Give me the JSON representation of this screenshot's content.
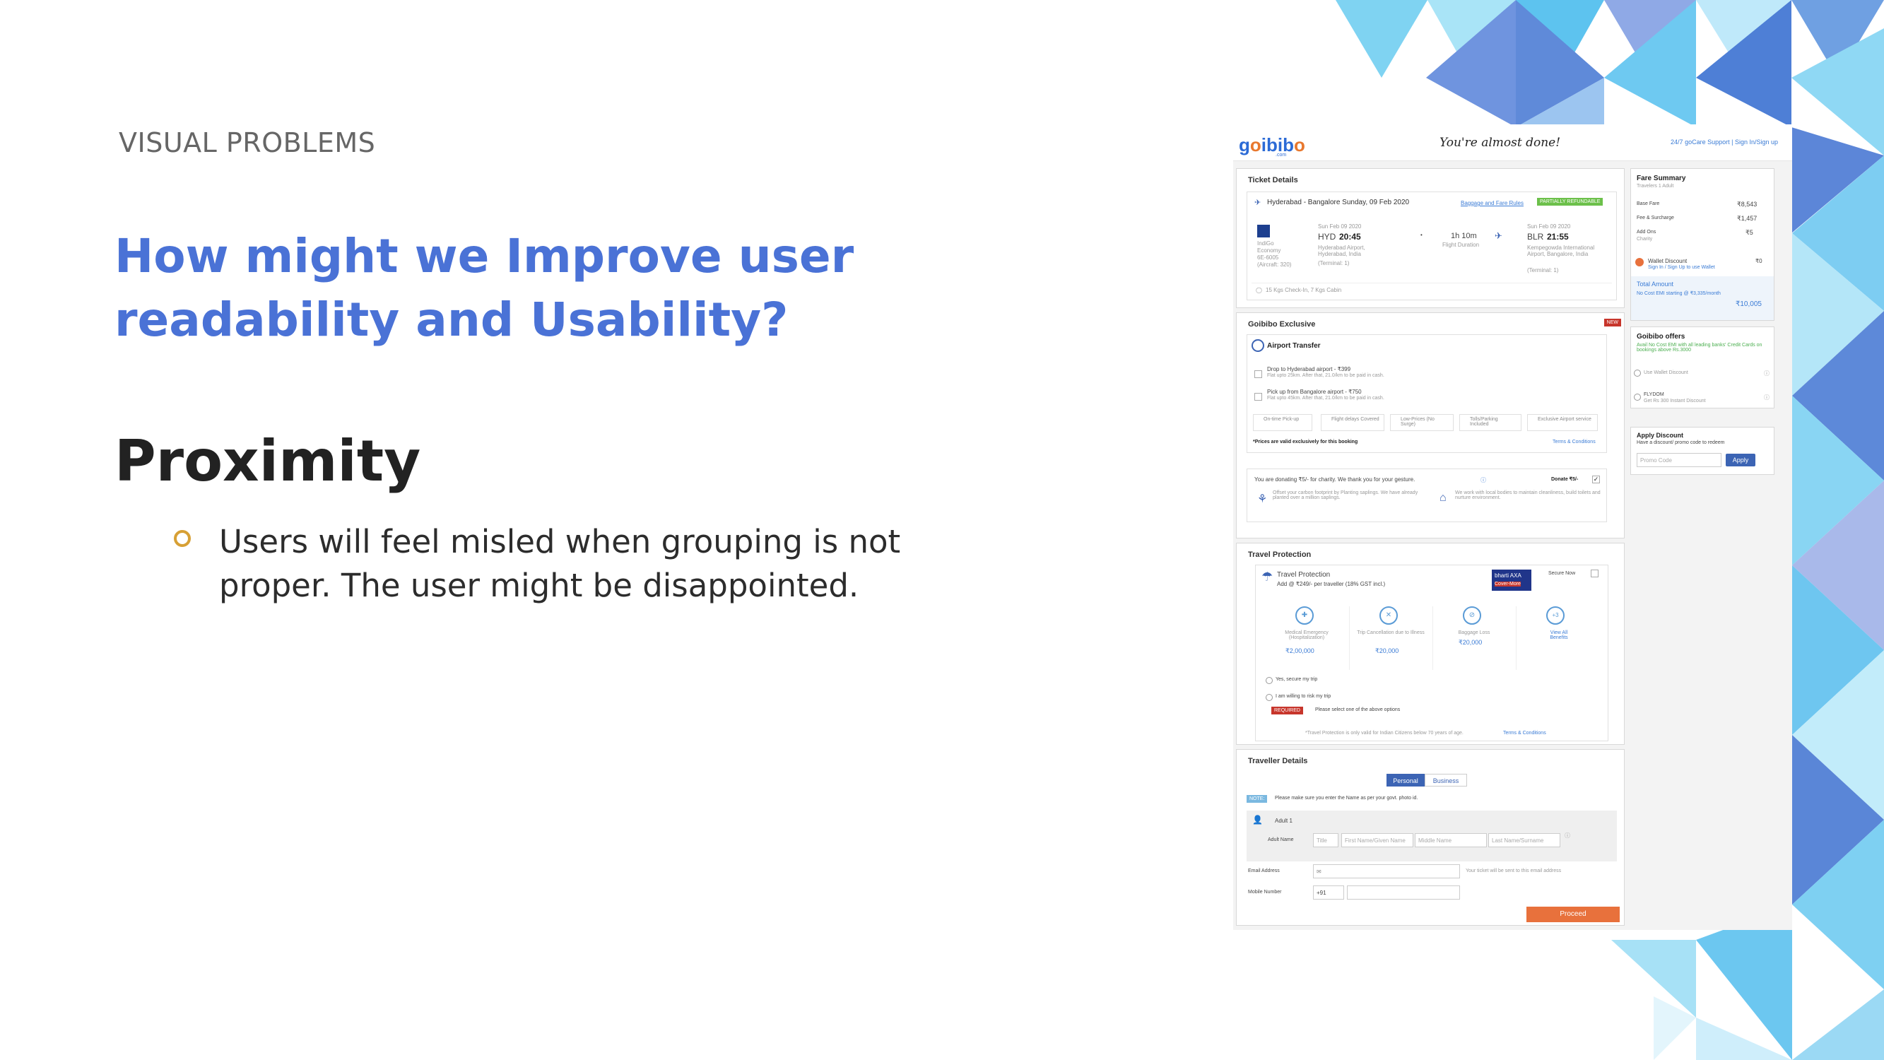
{
  "slide": {
    "section_label": "VISUAL PROBLEMS",
    "question": "How might we Improve user readability and Usability?",
    "principle": "Proximity",
    "bullet": "Users will feel misled when grouping is not proper. The user might be disappointed."
  },
  "colors": {
    "accent_blue": "#4a72d6",
    "bullet_ring": "#d7a035",
    "proceed": "#e8713c",
    "primary": "#3c64b4"
  },
  "screenshot": {
    "logo": "goibibo",
    "logo_sub": ".com",
    "tagline": "You're almost done!",
    "support": "24/7 goCare Support | Sign In/Sign up",
    "ticket": {
      "title": "Ticket Details",
      "route": "Hyderabad - Bangalore Sunday, 09 Feb 2020",
      "rules_link": "Baggage and Fare Rules",
      "refund_badge": "PARTIALLY REFUNDABLE",
      "airline": "IndiGo",
      "airline_class": "Economy",
      "flight_no": "6E-6005",
      "aircraft": "(Aircraft: 320)",
      "dep_date": "Sun Feb 09 2020",
      "dep_code": "HYD",
      "dep_time": "20:45",
      "dep_airport": "Hyderabad Airport, Hyderabad, India",
      "dep_terminal": "(Terminal: 1)",
      "duration": "1h 10m",
      "duration_label": "Flight Duration",
      "arr_date": "Sun Feb 09 2020",
      "arr_code": "BLR",
      "arr_time": "21:55",
      "arr_airport": "Kempegowda International Airport, Bangalore, India",
      "arr_terminal": "(Terminal: 1)",
      "baggage": "15 Kgs Check-In, 7 Kgs Cabin"
    },
    "exclusive": {
      "title": "Goibibo Exclusive",
      "new_badge": "NEW",
      "transfer_title": "Airport Transfer",
      "opt1": "Drop to Hyderabad airport - ₹399",
      "opt1_sub": "Flat upto 25km. After that, 21.0/km to be paid in cash.",
      "opt2": "Pick up from Bangalore airport - ₹750",
      "opt2_sub": "Flat upto 45km. After that, 21.0/km to be paid in cash.",
      "features": [
        "On-time Pick-up",
        "Flight delays Covered",
        "Low-Prices (No Surge)",
        "Tolls/Parking Included",
        "Exclusive Airport service"
      ],
      "prices_note": "*Prices are valid exclusively for this booking",
      "terms": "Terms & Conditions",
      "charity": "You are donating ₹5/- for charity. We thank you for your gesture.",
      "donate": "Donate ₹5/-",
      "charity_a": "Offset your carbon footprint by Planting saplings. We have already planted over a million saplings.",
      "charity_b": "We work with local bodies to maintain cleanliness, build toilets and nurture environment."
    },
    "protection": {
      "title": "Travel Protection",
      "box_title": "Travel Protection",
      "add_text": "Add @ ₹249/- per traveller (18% GST incl.)",
      "secure_now": "Secure Now",
      "insurer": "bharti AXA",
      "insurer_sub": "Cover-More",
      "benefits": [
        {
          "label": "Medical Emergency (Hospitalization)",
          "value": "₹2,00,000"
        },
        {
          "label": "Trip Cancellation due to Illness",
          "value": "₹20,000"
        },
        {
          "label": "Baggage Loss",
          "value": "₹20,000"
        },
        {
          "label": "View All Benefits",
          "value": "+3"
        }
      ],
      "yes": "Yes, secure my trip",
      "no": "I am willing to risk my trip",
      "required": "REQUIRED",
      "required_msg": "Please select one of the above options",
      "footnote": "*Travel Protection is only valid for Indian Citizens below 70 years of age.",
      "footnote_link": "Terms & Conditions"
    },
    "traveller": {
      "title": "Traveller Details",
      "tab_personal": "Personal",
      "tab_business": "Business",
      "note_tag": "NOTE:",
      "note": "Please make sure you enter the Name as per your govt. photo id.",
      "adult": "Adult 1",
      "name_label": "Adult Name",
      "title_select": "Title",
      "first_ph": "First Name/Given Name",
      "middle_ph": "Middle Name",
      "last_ph": "Last Name/Surname",
      "email_label": "Email Address",
      "email_hint": "Your ticket will be sent to this email address",
      "mobile_label": "Mobile Number",
      "code": "+91",
      "proceed": "Proceed"
    },
    "fare": {
      "title": "Fare Summary",
      "travelers": "Travelers 1 Adult",
      "rows": [
        {
          "label": "Base Fare",
          "value": "₹8,543"
        },
        {
          "label": "Fee & Surcharge",
          "value": "₹1,457"
        },
        {
          "label": "Add Ons",
          "value": "₹5"
        }
      ],
      "addons_sub": "Charity",
      "wallet": "Wallet Discount",
      "wallet_value": "₹0",
      "wallet_link": "Sign In / Sign Up to use Wallet",
      "total_label": "Total Amount",
      "emi": "No Cost EMI starting @ ₹3,335/month",
      "total": "₹10,005"
    },
    "offers": {
      "title": "Goibibo offers",
      "green": "Avail No Cost EMI with all leading banks' Credit Cards on bookings above Rs.3000",
      "use_wallet": "Use Wallet Discount",
      "flydom": "FLYDOM",
      "flydom_sub": "Get Rs 300 Instant Discount"
    },
    "discount": {
      "title": "Apply Discount",
      "sub": "Have a discount/ promo code to redeem",
      "placeholder": "Promo Code",
      "apply": "Apply"
    }
  }
}
